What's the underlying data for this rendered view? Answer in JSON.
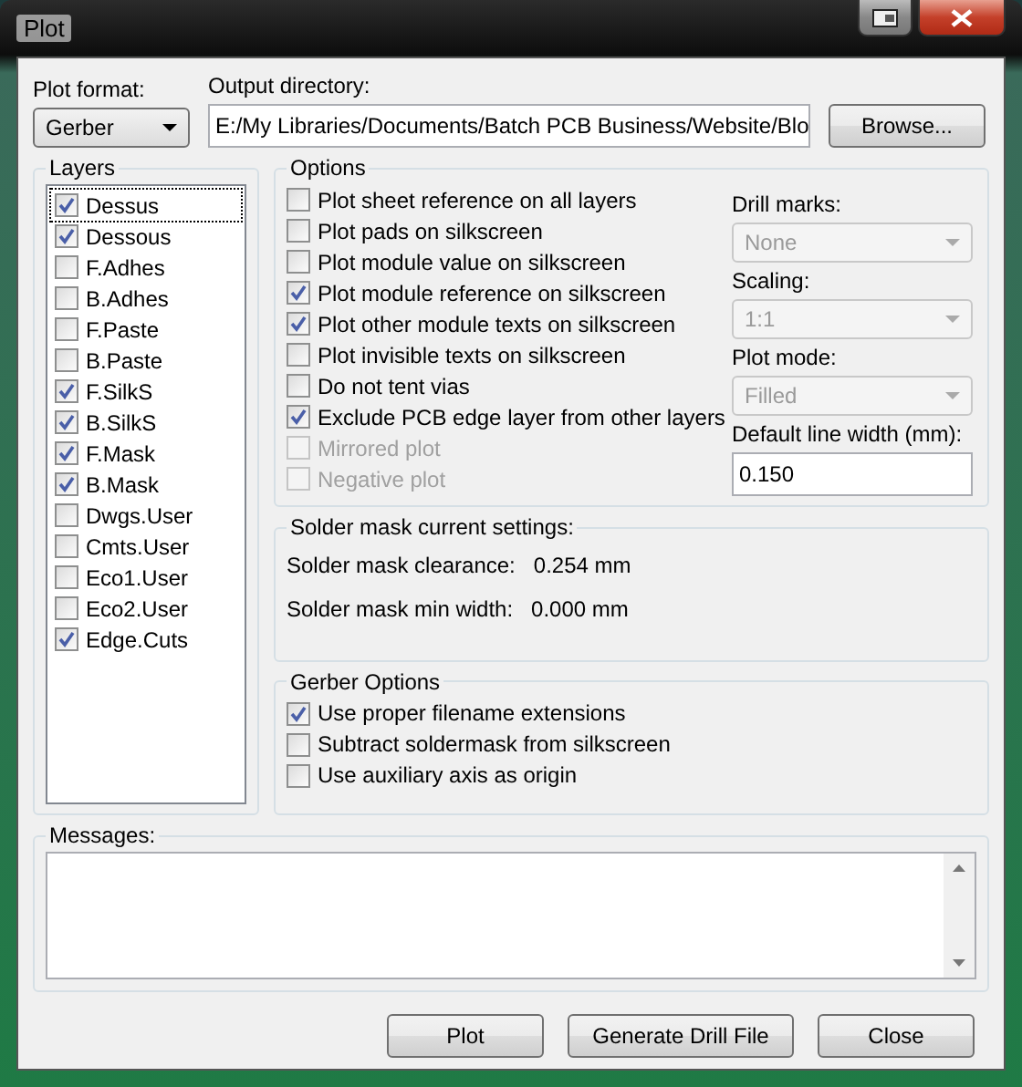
{
  "window": {
    "title": "Plot"
  },
  "plot_format": {
    "label": "Plot format:",
    "value": "Gerber"
  },
  "output_directory": {
    "label": "Output directory:",
    "value": "E:/My Libraries/Documents/Batch PCB Business/Website/Blo"
  },
  "browse_button": "Browse...",
  "layers": {
    "title": "Layers",
    "items": [
      {
        "label": "Dessus",
        "checked": true,
        "selected": true
      },
      {
        "label": "Dessous",
        "checked": true,
        "selected": false
      },
      {
        "label": "F.Adhes",
        "checked": false,
        "selected": false
      },
      {
        "label": "B.Adhes",
        "checked": false,
        "selected": false
      },
      {
        "label": "F.Paste",
        "checked": false,
        "selected": false
      },
      {
        "label": "B.Paste",
        "checked": false,
        "selected": false
      },
      {
        "label": "F.SilkS",
        "checked": true,
        "selected": false
      },
      {
        "label": "B.SilkS",
        "checked": true,
        "selected": false
      },
      {
        "label": "F.Mask",
        "checked": true,
        "selected": false
      },
      {
        "label": "B.Mask",
        "checked": true,
        "selected": false
      },
      {
        "label": "Dwgs.User",
        "checked": false,
        "selected": false
      },
      {
        "label": "Cmts.User",
        "checked": false,
        "selected": false
      },
      {
        "label": "Eco1.User",
        "checked": false,
        "selected": false
      },
      {
        "label": "Eco2.User",
        "checked": false,
        "selected": false
      },
      {
        "label": "Edge.Cuts",
        "checked": true,
        "selected": false
      }
    ]
  },
  "options": {
    "title": "Options",
    "checkboxes": [
      {
        "label": "Plot sheet reference on all layers",
        "checked": false,
        "disabled": false
      },
      {
        "label": "Plot pads on silkscreen",
        "checked": false,
        "disabled": false
      },
      {
        "label": "Plot module value on silkscreen",
        "checked": false,
        "disabled": false
      },
      {
        "label": "Plot module reference on silkscreen",
        "checked": true,
        "disabled": false
      },
      {
        "label": "Plot other module texts on silkscreen",
        "checked": true,
        "disabled": false
      },
      {
        "label": "Plot invisible texts on silkscreen",
        "checked": false,
        "disabled": false
      },
      {
        "label": "Do not tent vias",
        "checked": false,
        "disabled": false
      },
      {
        "label": "Exclude PCB edge layer from other layers",
        "checked": true,
        "disabled": false
      },
      {
        "label": "Mirrored plot",
        "checked": false,
        "disabled": true
      },
      {
        "label": "Negative plot",
        "checked": false,
        "disabled": true
      }
    ],
    "selects": [
      {
        "label": "Drill marks:",
        "value": "None",
        "disabled": true
      },
      {
        "label": "Scaling:",
        "value": "1:1",
        "disabled": true
      },
      {
        "label": "Plot mode:",
        "value": "Filled",
        "disabled": true
      }
    ],
    "line_width": {
      "label": "Default line width (mm):",
      "value": "0.150"
    }
  },
  "solder_mask": {
    "title": "Solder mask current settings:",
    "rows": [
      {
        "label": "Solder mask clearance:",
        "value": "0.254 mm"
      },
      {
        "label": "Solder mask min width:",
        "value": "0.000 mm"
      }
    ]
  },
  "gerber_options": {
    "title": "Gerber Options",
    "checkboxes": [
      {
        "label": "Use proper filename extensions",
        "checked": true,
        "disabled": false
      },
      {
        "label": "Subtract soldermask from silkscreen",
        "checked": false,
        "disabled": false
      },
      {
        "label": "Use auxiliary axis as origin",
        "checked": false,
        "disabled": false
      }
    ]
  },
  "messages": {
    "label": "Messages:"
  },
  "buttons": [
    "Plot",
    "Generate Drill File",
    "Close"
  ]
}
